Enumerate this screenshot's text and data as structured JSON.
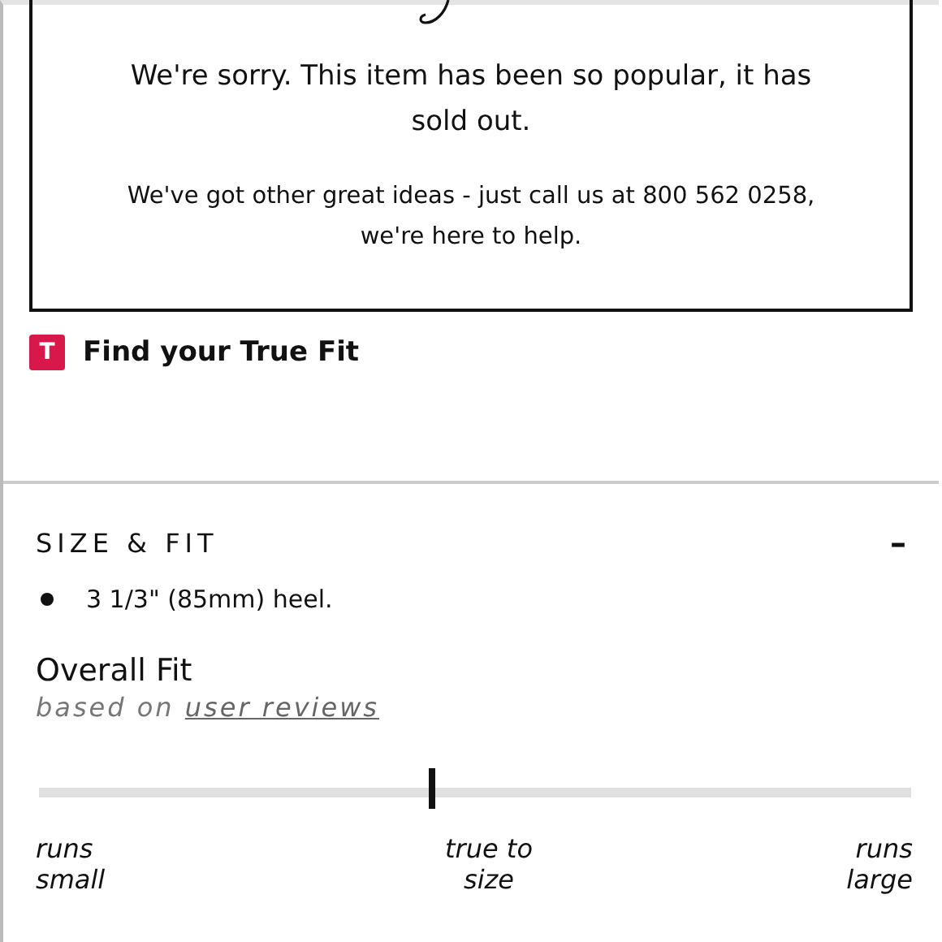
{
  "notice": {
    "headline": "We're sorry. This item has been so popular, it has sold out.",
    "message": "We've got other great ideas - just call us at 800 562 0258, we're here to help."
  },
  "true_fit": {
    "logo": "T",
    "label": "Find your True Fit"
  },
  "section": {
    "title": "SIZE & FIT",
    "expanded": true,
    "toggle": "–",
    "bullets": [
      "3 1/3\" (85mm) heel."
    ],
    "fit": {
      "title": "Overall Fit",
      "subtitle": "based on",
      "link": "user reviews",
      "level": 0.45,
      "labels": [
        "runs small",
        "true to size",
        "runs large"
      ]
    }
  }
}
